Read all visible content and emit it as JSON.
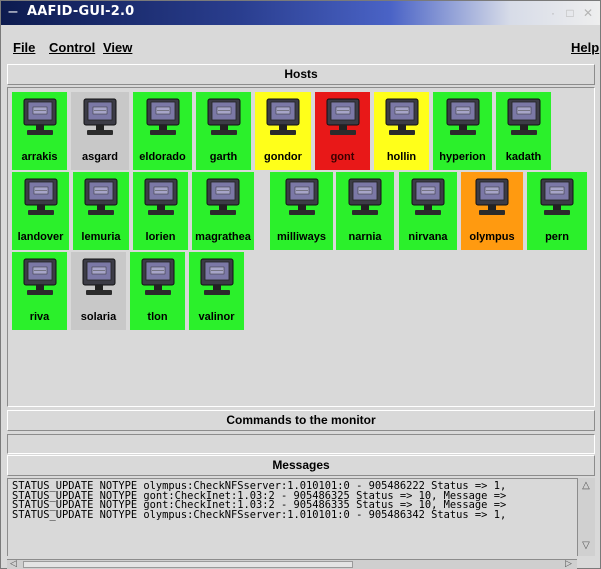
{
  "window": {
    "title": "AAFID-GUI-2.0"
  },
  "menubar": {
    "file": "File",
    "control": "Control",
    "view": "View",
    "help": "Help"
  },
  "hosts": {
    "header": "Hosts",
    "items": [
      {
        "name": "arrakis",
        "status_color": "green"
      },
      {
        "name": "asgard",
        "status_color": "grey"
      },
      {
        "name": "eldorado",
        "status_color": "green"
      },
      {
        "name": "garth",
        "status_color": "green"
      },
      {
        "name": "gondor",
        "status_color": "yellow"
      },
      {
        "name": "gont",
        "status_color": "red"
      },
      {
        "name": "hollin",
        "status_color": "yellow"
      },
      {
        "name": "hyperion",
        "status_color": "green"
      },
      {
        "name": "kadath",
        "status_color": "green"
      },
      {
        "name": "landover",
        "status_color": "green"
      },
      {
        "name": "lemuria",
        "status_color": "green"
      },
      {
        "name": "lorien",
        "status_color": "green"
      },
      {
        "name": "magrathea",
        "status_color": "green"
      },
      {
        "name": "milliways",
        "status_color": "green"
      },
      {
        "name": "narnia",
        "status_color": "green"
      },
      {
        "name": "nirvana",
        "status_color": "green"
      },
      {
        "name": "olympus",
        "status_color": "orange"
      },
      {
        "name": "pern",
        "status_color": "green"
      },
      {
        "name": "riva",
        "status_color": "green"
      },
      {
        "name": "solaria",
        "status_color": "grey"
      },
      {
        "name": "tlon",
        "status_color": "green"
      },
      {
        "name": "valinor",
        "status_color": "green"
      }
    ],
    "icon": "computer-monitor-icon"
  },
  "commands": {
    "header": "Commands to the monitor",
    "value": ""
  },
  "messages": {
    "header": "Messages",
    "lines": [
      "STATUS_UPDATE NOTYPE olympus:CheckNFSserver:1.010101:0 - 905486222 Status => 1,",
      "STATUS_UPDATE NOTYPE gont:CheckInet:1.03:2 - 905486325 Status => 10, Message =>",
      "STATUS_UPDATE NOTYPE gont:CheckInet:1.03:2 - 905486335 Status => 10, Message =>",
      "STATUS_UPDATE NOTYPE olympus:CheckNFSserver:1.010101:0 - 905486342 Status => 1,"
    ]
  },
  "colors": {
    "status_green": "#2bf02b",
    "status_grey": "#c8c8c8",
    "status_yellow": "#ffff1a",
    "status_red": "#e81818",
    "status_orange": "#ff9a10",
    "window_bg": "#d9d9d9"
  }
}
